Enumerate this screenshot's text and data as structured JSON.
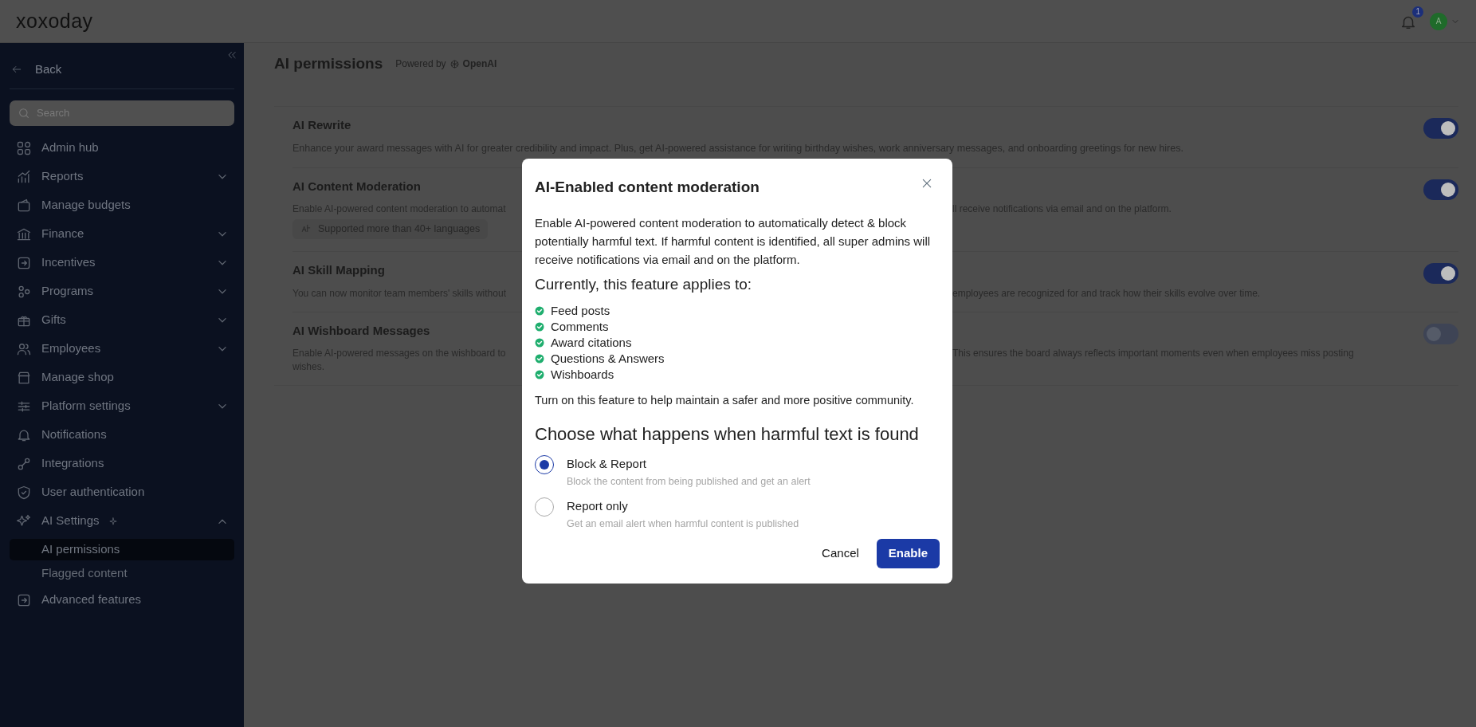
{
  "header": {
    "logo": "xoxoday",
    "notification_count": "1",
    "avatar_initial": "A"
  },
  "sidebar": {
    "back": "Back",
    "search": {
      "placeholder": "Search"
    },
    "items": [
      {
        "label": "Admin hub",
        "has_submenu": false
      },
      {
        "label": "Reports",
        "has_submenu": true,
        "expanded": false
      },
      {
        "label": "Manage budgets",
        "has_submenu": false
      },
      {
        "label": "Finance",
        "has_submenu": true,
        "expanded": false
      },
      {
        "label": "Incentives",
        "has_submenu": true,
        "expanded": false
      },
      {
        "label": "Programs",
        "has_submenu": true,
        "expanded": false
      },
      {
        "label": "Gifts",
        "has_submenu": true,
        "expanded": false
      },
      {
        "label": "Employees",
        "has_submenu": true,
        "expanded": false
      },
      {
        "label": "Manage shop",
        "has_submenu": false
      },
      {
        "label": "Platform settings",
        "has_submenu": true,
        "expanded": false
      },
      {
        "label": "Notifications",
        "has_submenu": false
      },
      {
        "label": "Integrations",
        "has_submenu": false
      },
      {
        "label": "User authentication",
        "has_submenu": false
      },
      {
        "label": "AI Settings",
        "has_submenu": true,
        "expanded": true,
        "children": [
          {
            "label": "AI permissions",
            "selected": true
          },
          {
            "label": "Flagged content",
            "selected": false
          }
        ]
      },
      {
        "label": "Advanced features",
        "has_submenu": false
      }
    ]
  },
  "page": {
    "title": "AI permissions",
    "powered_by": "Powered by",
    "brand": "OpenAI"
  },
  "features": [
    {
      "title": "AI Rewrite",
      "on": true,
      "description": [
        {
          "kind": "full",
          "text": "Enhance your award messages with AI for greater credibility and impact. Plus, get AI-powered assistance for writing birthday wishes, work anniversary messages, and onboarding greetings for new hires."
        }
      ]
    },
    {
      "title": "AI Content Moderation",
      "on": true,
      "description": [
        {
          "kind": "left",
          "text": "Enable AI-powered content moderation to automat"
        },
        {
          "kind": "right",
          "text": "ll receive notifications via email and on the platform."
        }
      ],
      "tag": "Supported more than 40+ languages"
    },
    {
      "title": "AI Skill Mapping",
      "on": true,
      "description": [
        {
          "kind": "left",
          "text": "You can now monitor team members' skills without"
        },
        {
          "kind": "right",
          "text": "employees are recognized for and track how their skills evolve over time."
        }
      ]
    },
    {
      "title": "AI Wishboard Messages",
      "on": false,
      "description": [
        {
          "kind": "left",
          "text": "Enable AI-powered messages on the wishboard to"
        },
        {
          "kind": "right",
          "text": "This ensures the board always reflects important moments even when employees miss posting"
        },
        {
          "kind": "left",
          "text": "wishes."
        }
      ]
    }
  ],
  "modal": {
    "title": "AI-Enabled content moderation",
    "intro": "Enable AI-powered content moderation to automatically detect & block potentially harmful text. If harmful content is identified, all super admins will receive notifications via email and on the platform.",
    "applies_heading": "Currently, this feature applies to:",
    "applies_items": [
      "Feed posts",
      "Comments",
      "Award citations",
      "Questions & Answers",
      "Wishboards"
    ],
    "note": "Turn on this feature to help maintain a safer and more positive community.",
    "choice_heading": "Choose what happens when harmful text is found",
    "options": [
      {
        "label": "Block & Report",
        "hint": "Block the content from being published and get an alert",
        "selected": true
      },
      {
        "label": "Report only",
        "hint": "Get an email alert when harmful content is published",
        "selected": false
      }
    ],
    "cancel": "Cancel",
    "confirm": "Enable"
  }
}
